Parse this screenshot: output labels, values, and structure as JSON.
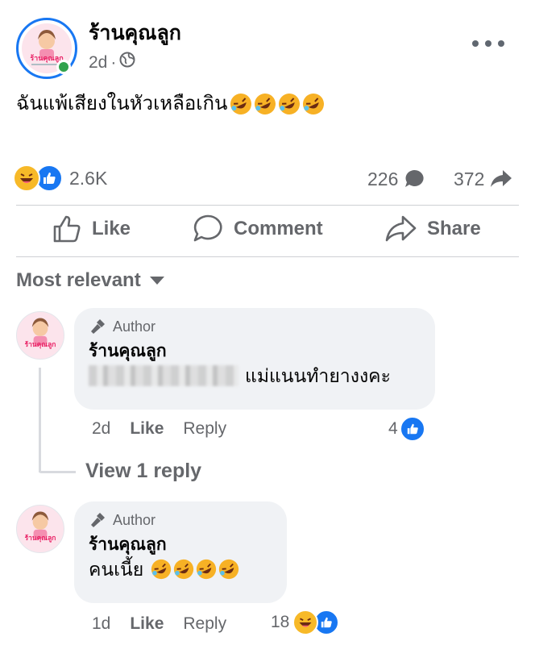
{
  "post": {
    "page_name": "ร้านคุณลูก",
    "avatar_text": "ร้านคุณลูก",
    "time": "2d",
    "separator": "·",
    "text": "ฉันแพ้เสียงในหัวเหลือเกิน"
  },
  "stats": {
    "reaction_count": "2.6K",
    "comments": "226",
    "shares": "372"
  },
  "actions": {
    "like": "Like",
    "comment": "Comment",
    "share": "Share"
  },
  "sort": {
    "label": "Most relevant"
  },
  "comments": [
    {
      "badge": "Author",
      "name": "ร้านคุณลูก",
      "text": "แม่แนนทำยางงคะ",
      "time": "2d",
      "like_label": "Like",
      "reply_label": "Reply",
      "reaction_count": "4"
    },
    {
      "badge": "Author",
      "name": "ร้านคุณลูก",
      "text": "คนเนี้ย",
      "time": "1d",
      "like_label": "Like",
      "reply_label": "Reply",
      "reaction_count": "18"
    }
  ],
  "view_reply": "View 1 reply",
  "colors": {
    "brand_blue": "#1877f2",
    "online_green": "#31a24c",
    "muted_text": "#65676b",
    "bubble_bg": "#f0f2f5",
    "haha_yellow": "#f7b928"
  }
}
